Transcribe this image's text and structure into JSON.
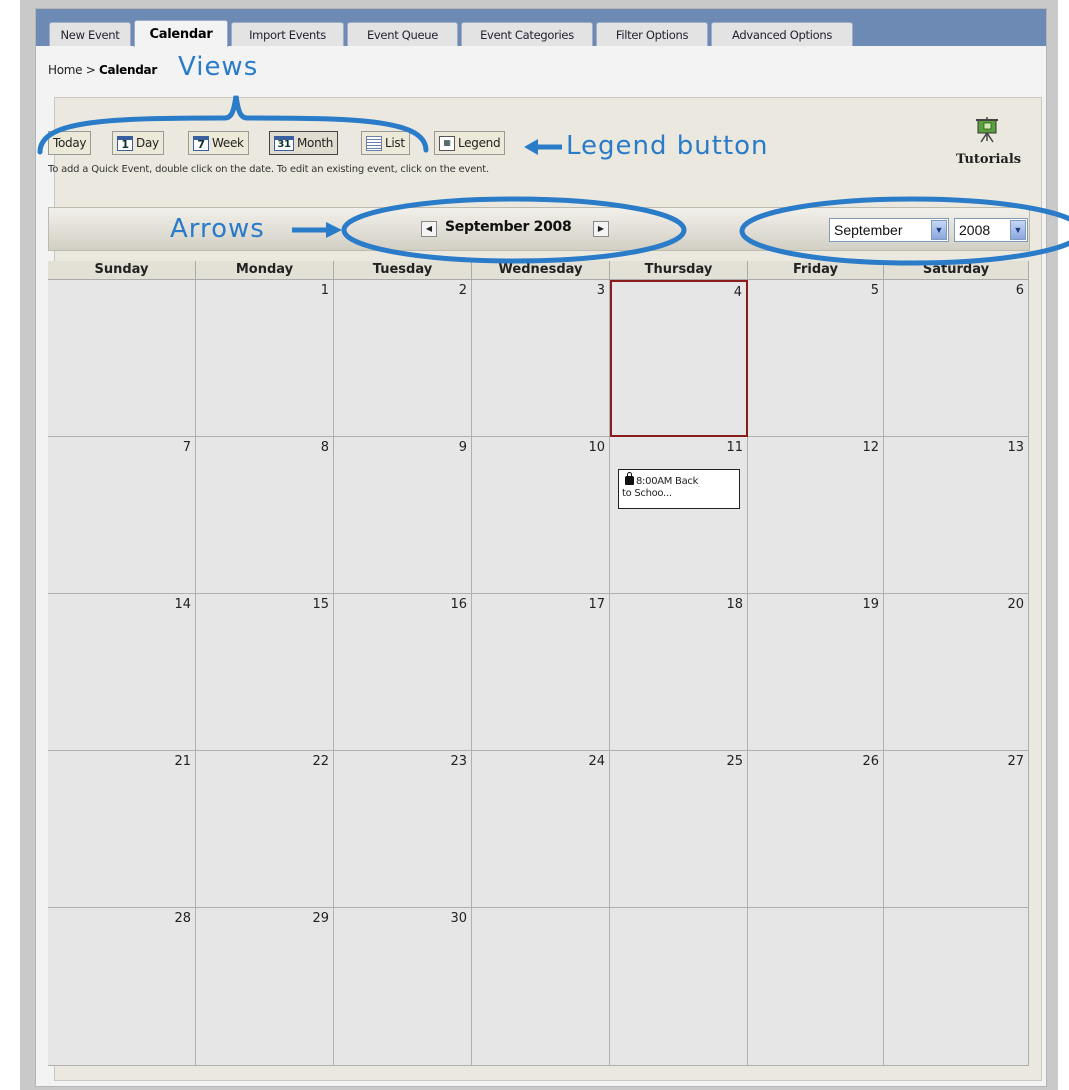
{
  "tabs": [
    "New Event",
    "Calendar",
    "Import Events",
    "Event Queue",
    "Event Categories",
    "Filter Options",
    "Advanced Options"
  ],
  "active_tab": "Calendar",
  "breadcrumb": {
    "home": "Home",
    "separator": ">",
    "current": "Calendar"
  },
  "views": {
    "today": "Today",
    "day": "Day",
    "day_icon": "1",
    "week": "Week",
    "week_icon": "7",
    "month": "Month",
    "month_icon": "31",
    "list": "List",
    "legend": "Legend"
  },
  "hint": "To add a Quick Event, double click on the date. To edit an existing event, click on the event.",
  "tutorials": {
    "label": "Tutorials",
    "icon": "presentation-board-icon"
  },
  "nav": {
    "title": "September 2008",
    "prev_icon": "arrow-left-icon",
    "next_icon": "arrow-right-icon"
  },
  "selectors": {
    "month": "September",
    "year": "2008"
  },
  "weekdays": [
    "Sunday",
    "Monday",
    "Tuesday",
    "Wednesday",
    "Thursday",
    "Friday",
    "Saturday"
  ],
  "today": 4,
  "weeks": [
    [
      "",
      "1",
      "2",
      "3",
      "4",
      "5",
      "6"
    ],
    [
      "7",
      "8",
      "9",
      "10",
      "11",
      "12",
      "13"
    ],
    [
      "14",
      "15",
      "16",
      "17",
      "18",
      "19",
      "20"
    ],
    [
      "21",
      "22",
      "23",
      "24",
      "25",
      "26",
      "27"
    ],
    [
      "28",
      "29",
      "30",
      "",
      "",
      "",
      ""
    ]
  ],
  "events": [
    {
      "day": "11",
      "line1": "8:00AM Back",
      "line2": "to Schoo...",
      "icon": "lock-icon"
    }
  ],
  "annotations": {
    "views": "Views",
    "legend_button": "Legend button",
    "arrows": "Arrows",
    "color": "#2a7bc8"
  }
}
